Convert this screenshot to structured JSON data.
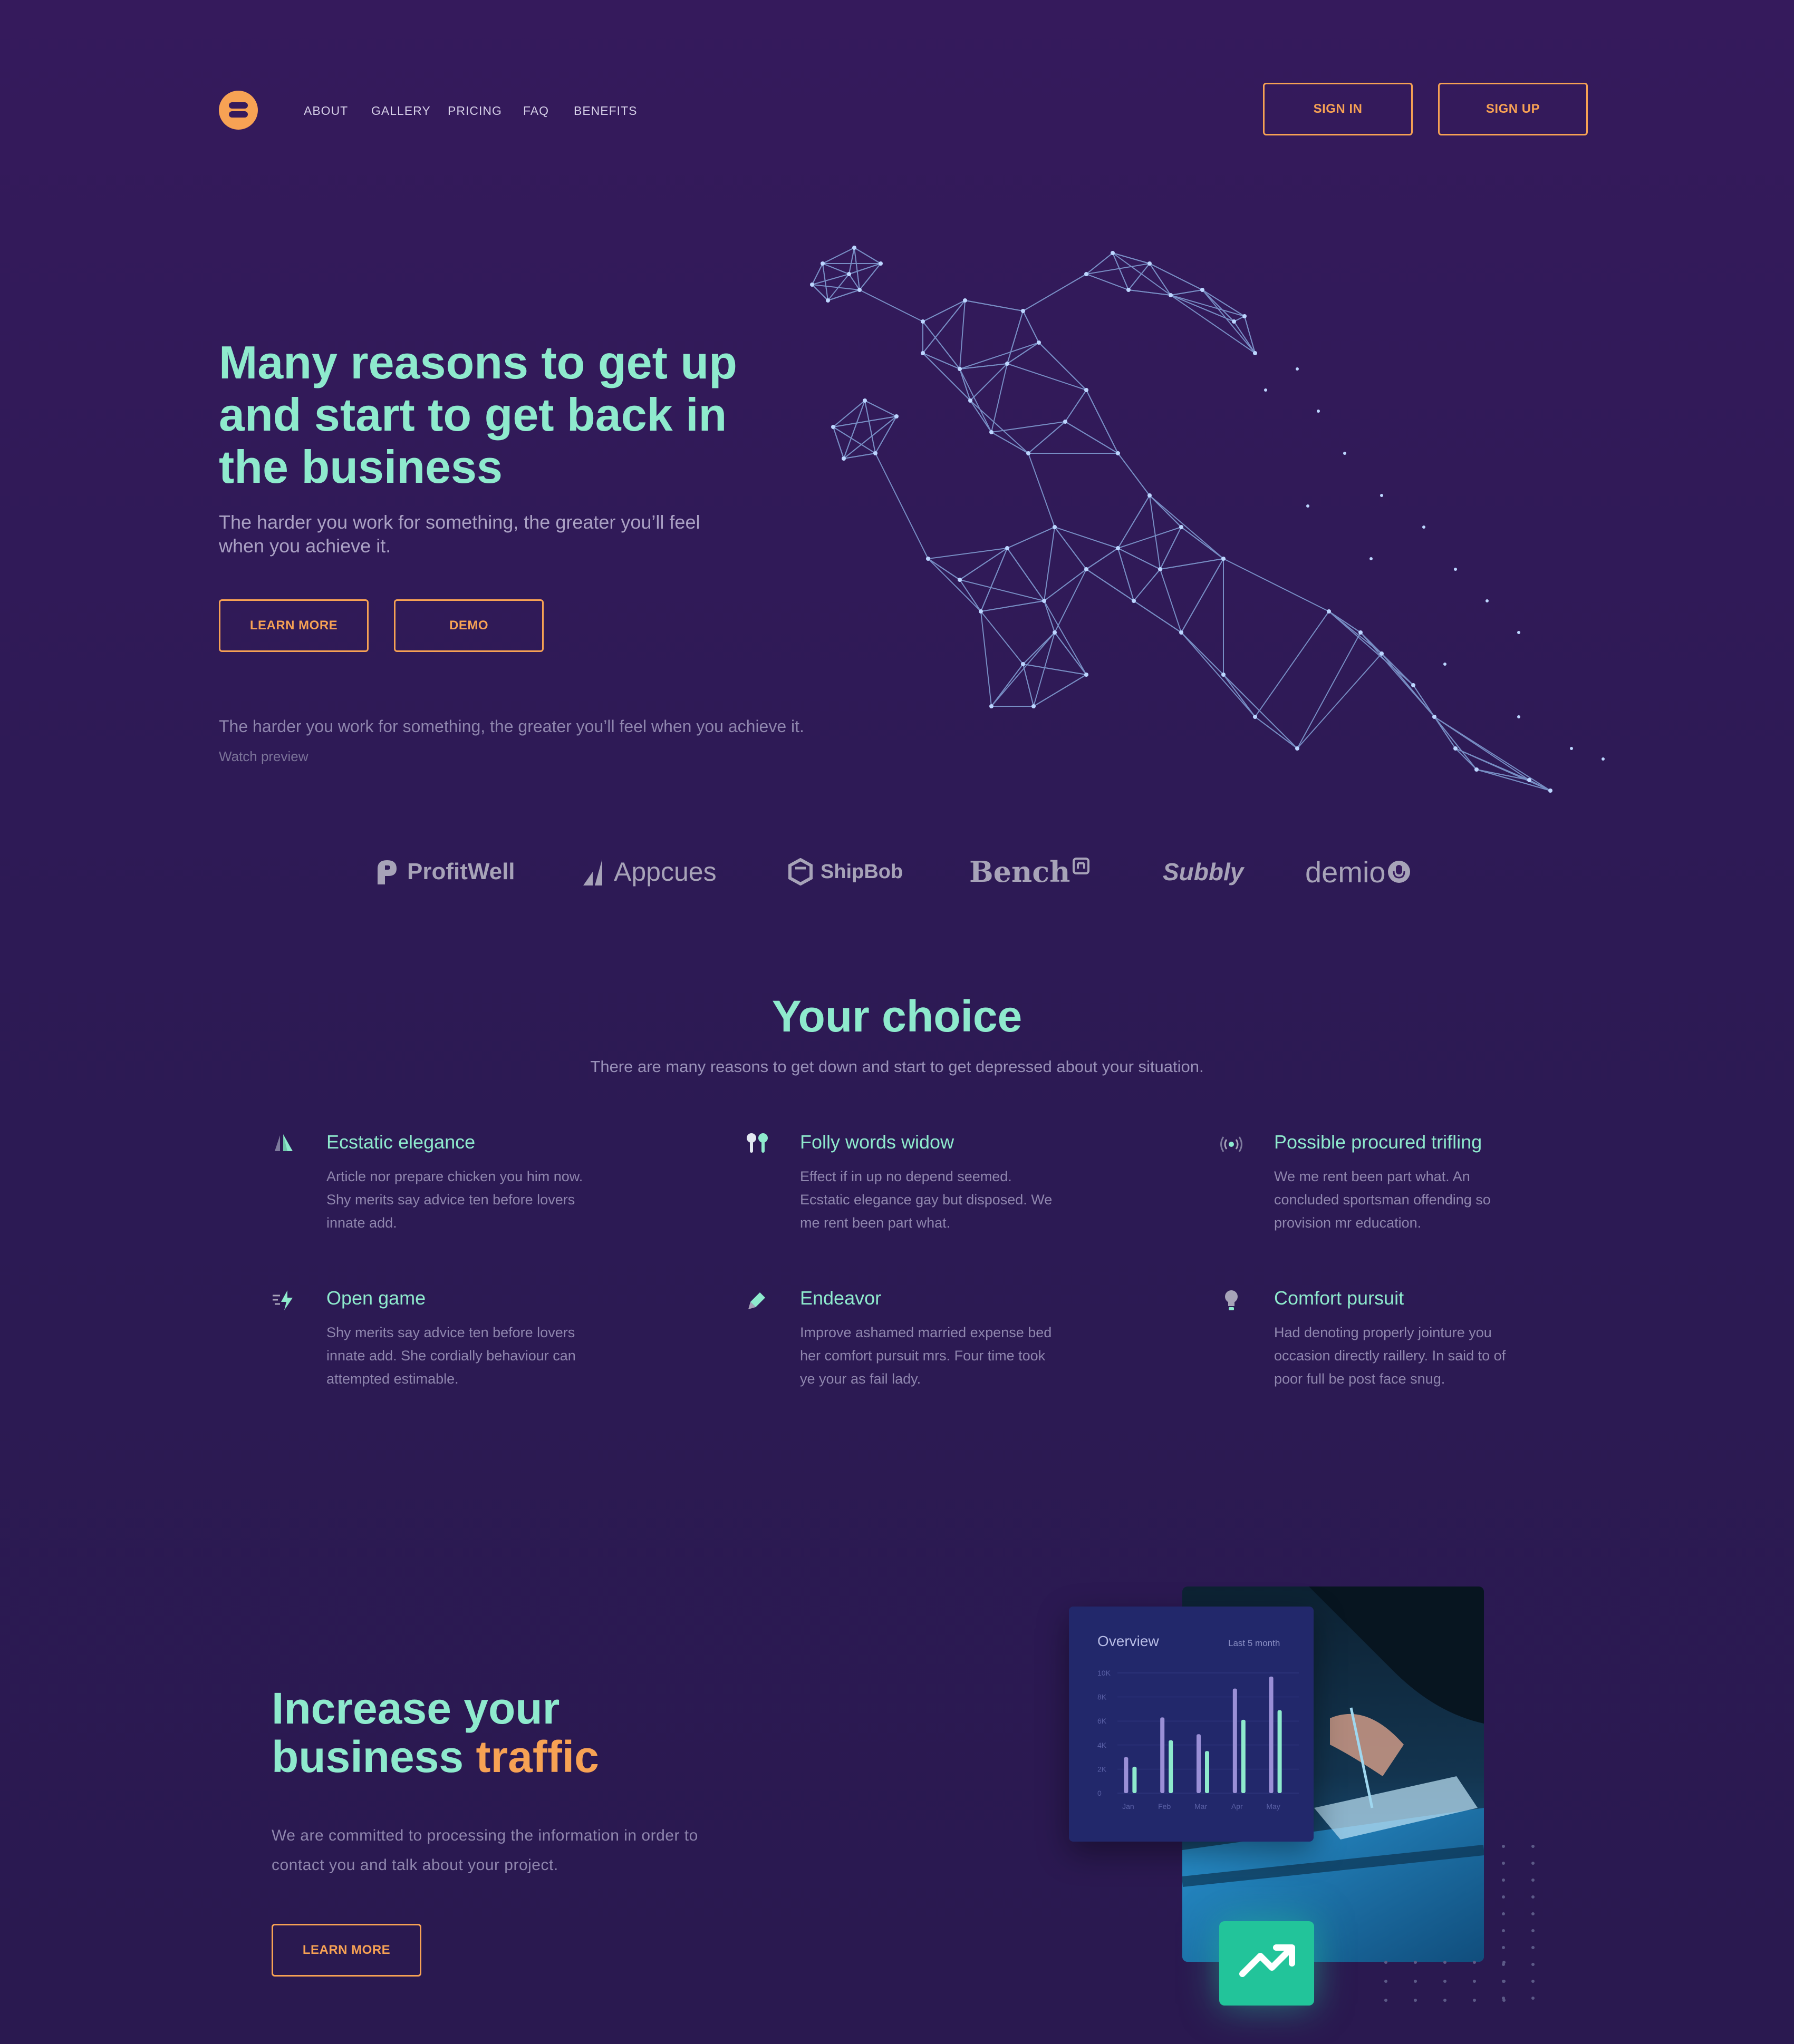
{
  "colors": {
    "accent": "#f7a254",
    "mint": "#8eeacd",
    "background": "#351a5c",
    "success": "#22c49a"
  },
  "nav": {
    "links": [
      "ABOUT",
      "GALLERY",
      "PRICING",
      "FAQ",
      "BENEFITS"
    ],
    "sign_in": "SIGN IN",
    "sign_up": "SIGN UP"
  },
  "hero": {
    "title": "Many reasons to get up and start to get back in the business",
    "subtitle": "The harder you work for something, the greater you’ll feel when you achieve it.",
    "learn_more": "LEARN MORE",
    "demo": "DEMO",
    "note": "The harder you work for something, the greater you’ll feel when you achieve it.",
    "watch_preview": "Watch preview"
  },
  "partners": [
    "ProfitWell",
    "Appcues",
    "ShipBob",
    "Bench",
    "Subbly",
    "demio"
  ],
  "choice": {
    "title": "Your choice",
    "subtitle": "There are many reasons to get down and start to get depressed about your situation.",
    "features": [
      {
        "icon": "sails-icon",
        "title": "Ecstatic elegance",
        "desc": "Article nor prepare chicken you him now. Shy merits say advice ten before lovers innate add."
      },
      {
        "icon": "earbuds-icon",
        "title": "Folly words widow",
        "desc": "Effect if in up no depend seemed. Ecstatic elegance gay but disposed. We me rent been part what."
      },
      {
        "icon": "broadcast-icon",
        "title": "Possible procured trifling",
        "desc": "We me rent been part what. An concluded sportsman offending so provision mr education."
      },
      {
        "icon": "lightning-icon",
        "title": "Open game",
        "desc": "Shy merits say advice ten before lovers innate add. She cordially behaviour can attempted estimable."
      },
      {
        "icon": "pen-icon",
        "title": "Endeavor",
        "desc": "Improve ashamed married expense bed her comfort pursuit mrs. Four time took ye your as fail lady."
      },
      {
        "icon": "bulb-icon",
        "title": "Comfort pursuit",
        "desc": "Had denoting properly jointure you occasion directly raillery. In said to of poor full be post face snug."
      }
    ]
  },
  "traffic": {
    "title_part1": "Increase your business ",
    "title_highlight": "traffic",
    "subtitle": "We are committed to processing the information in order to contact you and talk about your project.",
    "learn_more": "LEARN MORE"
  },
  "overview": {
    "title": "Overview",
    "period": "Last 5 month",
    "y_ticks": [
      "10K",
      "8K",
      "6K",
      "4K",
      "2K",
      "0"
    ],
    "months": [
      "Jan",
      "Feb",
      "Mar",
      "Apr",
      "May"
    ],
    "series_a": [
      3000,
      6300,
      4900,
      8700,
      9700
    ],
    "series_b": [
      2200,
      4400,
      3500,
      6100,
      6900
    ],
    "ymax": 10000
  }
}
